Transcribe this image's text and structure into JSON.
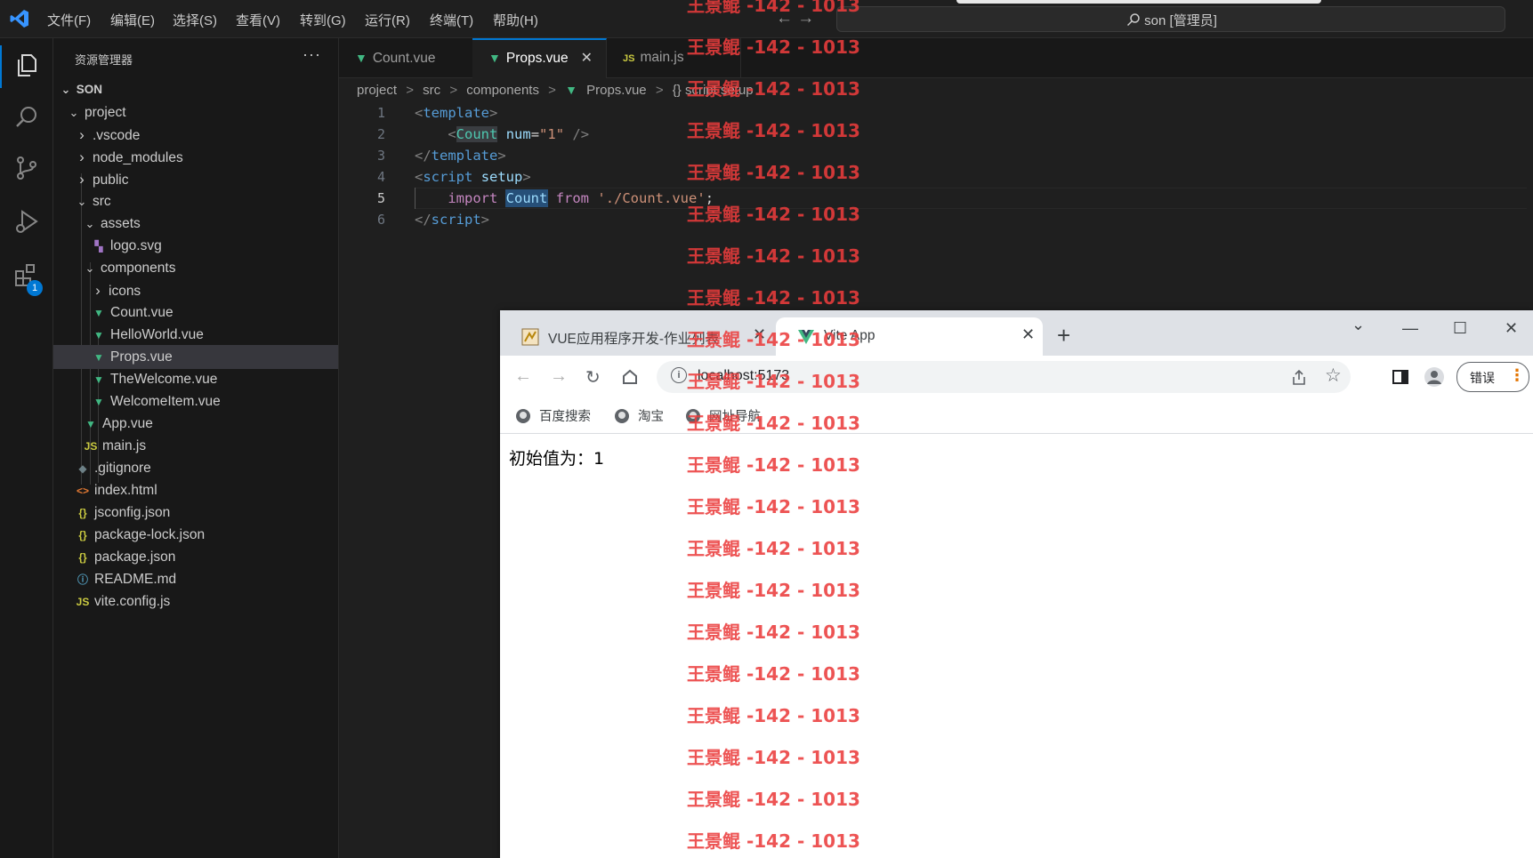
{
  "titlebar": {
    "menu": [
      "文件(F)",
      "编辑(E)",
      "选择(S)",
      "查看(V)",
      "转到(G)",
      "运行(R)",
      "终端(T)",
      "帮助(H)"
    ],
    "nav_arrows": "←  →",
    "command_center": "son [管理员]"
  },
  "activitybar": {
    "items": [
      "explorer-icon",
      "search-icon",
      "source-control-icon",
      "run-debug-icon",
      "extensions-icon"
    ],
    "extensions_badge": "1",
    "accent": "#0078d4"
  },
  "sidebar": {
    "title": "资源管理器",
    "more": "···",
    "root": "SON",
    "tree": [
      {
        "label": "project",
        "type": "folder",
        "open": true
      },
      {
        "label": ".vscode",
        "type": "folder"
      },
      {
        "label": "node_modules",
        "type": "folder"
      },
      {
        "label": "public",
        "type": "folder"
      },
      {
        "label": "src",
        "type": "folder",
        "open": true
      },
      {
        "label": "assets",
        "type": "folder",
        "open": true
      },
      {
        "label": "logo.svg",
        "type": "svg"
      },
      {
        "label": "components",
        "type": "folder",
        "open": true
      },
      {
        "label": "icons",
        "type": "folder"
      },
      {
        "label": "Count.vue",
        "type": "vue"
      },
      {
        "label": "HelloWorld.vue",
        "type": "vue"
      },
      {
        "label": "Props.vue",
        "type": "vue",
        "selected": true
      },
      {
        "label": "TheWelcome.vue",
        "type": "vue"
      },
      {
        "label": "WelcomeItem.vue",
        "type": "vue"
      },
      {
        "label": "App.vue",
        "type": "vue"
      },
      {
        "label": "main.js",
        "type": "js"
      },
      {
        "label": ".gitignore",
        "type": "git"
      },
      {
        "label": "index.html",
        "type": "html"
      },
      {
        "label": "jsconfig.json",
        "type": "json"
      },
      {
        "label": "package-lock.json",
        "type": "json"
      },
      {
        "label": "package.json",
        "type": "json"
      },
      {
        "label": "README.md",
        "type": "info"
      },
      {
        "label": "vite.config.js",
        "type": "js"
      }
    ]
  },
  "editor": {
    "tabs": [
      {
        "label": "Count.vue",
        "icon": "vue"
      },
      {
        "label": "Props.vue",
        "icon": "vue",
        "active": true,
        "close": "✕"
      },
      {
        "label": "main.js",
        "icon": "js"
      }
    ],
    "breadcrumb": [
      "project",
      ">",
      "src",
      ">",
      "components",
      ">",
      "Props.vue",
      ">",
      "{} script setup"
    ],
    "line_numbers": [
      "1",
      "2",
      "3",
      "4",
      "5",
      "6"
    ],
    "current_line": "5",
    "code": {
      "l1": {
        "open": "<",
        "tag": "template",
        "close": ">"
      },
      "l2": {
        "open": "<",
        "comp": "Count",
        "attr": "num",
        "eq": "=",
        "str": "\"1\"",
        "close": " />"
      },
      "l3": {
        "open": "</",
        "tag": "template",
        "close": ">"
      },
      "l4": {
        "open": "<",
        "tag": "script",
        "attr": "setup",
        "close": ">"
      },
      "l5": {
        "kw1": "import",
        "var": "Count",
        "kw2": "from",
        "str": "'./Count.vue'",
        "semi": ";"
      },
      "l6": {
        "open": "</",
        "tag": "script",
        "close": ">"
      }
    }
  },
  "browser": {
    "tabs": [
      {
        "title": "VUE应用程序开发-作业列表",
        "close": "✕"
      },
      {
        "title": "Vite App",
        "close": "✕",
        "active": true
      }
    ],
    "new_tab": "+",
    "window_controls": [
      "⌄",
      "—",
      "☐",
      "✕"
    ],
    "url": "localhost:5173",
    "error_button": "错误",
    "error_menu": "⋮",
    "bookmarks": [
      "百度搜索",
      "淘宝",
      "网址导航"
    ],
    "page_text": "初始值为：1"
  },
  "watermark": {
    "text": "王景鲲 -142 - 1013",
    "color": "#eb3c3c"
  }
}
